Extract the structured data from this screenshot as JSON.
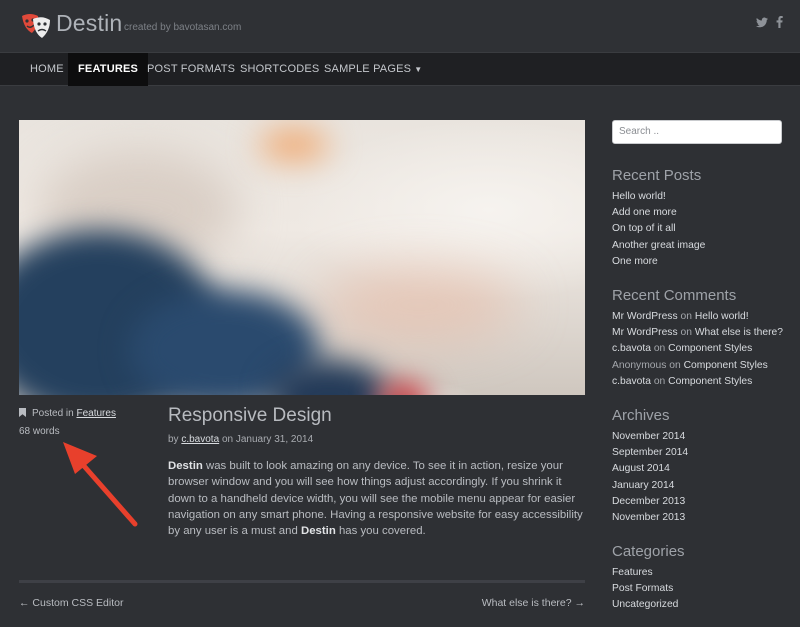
{
  "header": {
    "site_title": "Destin",
    "tagline": "created by bavotasan.com",
    "social": [
      {
        "icon": "twitter-icon",
        "glyph": "𝕥"
      },
      {
        "icon": "facebook-icon",
        "glyph": "f"
      }
    ]
  },
  "nav": {
    "items": [
      {
        "label": "HOME"
      },
      {
        "label": "FEATURES",
        "active": true
      },
      {
        "label": "POST FORMATS"
      },
      {
        "label": "SHORTCODES"
      },
      {
        "label": "SAMPLE PAGES",
        "has_dropdown": true
      }
    ]
  },
  "post": {
    "category_prefix": "Posted in",
    "category": "Features",
    "word_count": "68 words",
    "title": "Responsive Design",
    "byline_prefix": "by",
    "author": "c.bavota",
    "date_prefix": "on",
    "date": "January 31, 2014",
    "body": {
      "brand1": "Destin",
      "text1": " was built to look amazing on any device. To see it in action, resize your browser window and you will see how things adjust accordingly. If you shrink it down to a handheld device width, you will see the mobile menu appear for easier navigation on any smart phone. Having a responsive website for easy accessibility by any user is a must and ",
      "brand2": "Destin",
      "text2": " has you covered."
    }
  },
  "post_nav": {
    "prev": "← Custom CSS Editor",
    "next": "What else is there? →"
  },
  "sidebar": {
    "search_placeholder": "Search ..",
    "recent_posts": {
      "title": "Recent Posts",
      "items": [
        "Hello world!",
        "Add one more",
        "On top of it all",
        "Another great image",
        "One more"
      ]
    },
    "recent_comments": {
      "title": "Recent Comments",
      "items": [
        {
          "author": "Mr WordPress",
          "on": "on",
          "post": "Hello world!"
        },
        {
          "author": "Mr WordPress",
          "on": "on",
          "post": "What else is there?"
        },
        {
          "author": "c.bavota",
          "on": "on",
          "post": "Component Styles"
        },
        {
          "author": "Anonymous",
          "on": "on",
          "post": "Component Styles"
        },
        {
          "author": "c.bavota",
          "on": "on",
          "post": "Component Styles"
        }
      ]
    },
    "archives": {
      "title": "Archives",
      "items": [
        "November 2014",
        "September 2014",
        "August 2014",
        "January 2014",
        "December 2013",
        "November 2013"
      ]
    },
    "categories": {
      "title": "Categories",
      "items": [
        "Features",
        "Post Formats",
        "Uncategorized"
      ]
    }
  },
  "colors": {
    "background": "#2e3034",
    "nav_background": "#1f2023",
    "nav_active": "#0d0d0e",
    "annotation_arrow": "#e8402c",
    "logo_red": "#e0493a"
  }
}
